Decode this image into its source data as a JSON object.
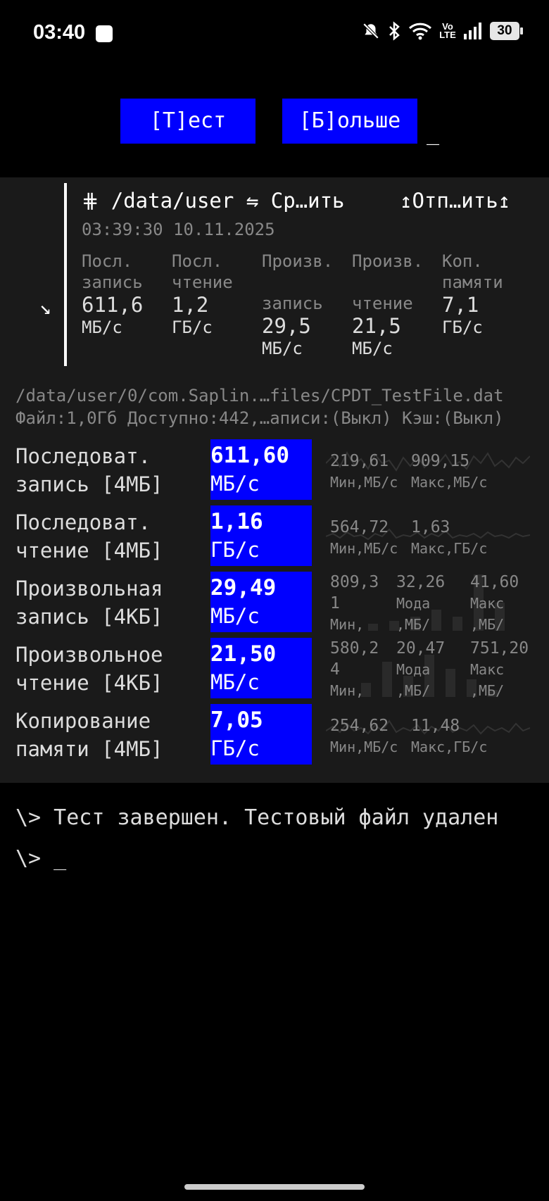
{
  "status_bar": {
    "time": "03:40",
    "battery": "30",
    "volte": "Vo LTE",
    "icons": [
      "notification-app-icon",
      "mute-icon",
      "bluetooth-icon",
      "wifi-icon",
      "volte-icon",
      "signal-icon",
      "battery-icon"
    ]
  },
  "toolbar": {
    "test_label": "[Т]ест",
    "more_label": "[Б]ольше",
    "cursor": "_"
  },
  "summary": {
    "header_left": "⋕  /data/user ⇋ Ср…ить",
    "header_right": "↥Отп…ить↥",
    "date": "03:39:30 10.11.2025",
    "arrow": "↘",
    "columns": [
      {
        "label1": "Посл.",
        "label2": "запись",
        "value": "611,6",
        "unit": "МБ/с"
      },
      {
        "label1": "Посл.",
        "label2": "чтение",
        "value": "1,2",
        "unit": "ГБ/с"
      },
      {
        "label1": "Произв.",
        "label2": "запись",
        "value": "29,5",
        "unit": "МБ/с"
      },
      {
        "label1": "Произв.",
        "label2": "чтение",
        "value": "21,5",
        "unit": "МБ/с"
      },
      {
        "label1": "Коп.",
        "label2": "памяти",
        "value": "7,1",
        "unit": "ГБ/с"
      }
    ]
  },
  "file_path": "/data/user/0/com.Saplin.…files/CPDT_TestFile.dat",
  "file_info": "Файл:1,0Гб Доступно:442,…аписи:(Выкл) Кэш:(Выкл)",
  "results": [
    {
      "name1": "Последоват.",
      "name2": "запись [4МБ]",
      "value": "611,60",
      "unit": "МБ/с",
      "stats": [
        {
          "v": "219,61",
          "l": "Мин,МБ/с"
        },
        {
          "v": "909,15",
          "l": "Макс,МБ/с"
        }
      ]
    },
    {
      "name1": "Последоват.",
      "name2": "чтение [4МБ]",
      "value": "1,16",
      "unit": "ГБ/с",
      "stats": [
        {
          "v": "564,72",
          "l": "Мин,МБ/с"
        },
        {
          "v": "1,63",
          "l": "Макс,ГБ/с"
        }
      ]
    },
    {
      "name1": "Произвольная",
      "name2": "запись [4КБ]",
      "value": "29,49",
      "unit": "МБ/с",
      "stats": [
        {
          "v": "809,3",
          "v2": "1",
          "l": "Мин,"
        },
        {
          "v": "32,26",
          "v2": "Мода",
          "l": ",МБ/"
        },
        {
          "v": "41,60",
          "v2": "Макс",
          "l": ",МБ/"
        }
      ]
    },
    {
      "name1": "Произвольное",
      "name2": "чтение [4КБ]",
      "value": "21,50",
      "unit": "МБ/с",
      "stats": [
        {
          "v": "580,2",
          "v2": "4",
          "l": "Мин,"
        },
        {
          "v": "20,47",
          "v2": "Мода",
          "l": ",МБ/"
        },
        {
          "v": "751,20",
          "v2": "Макс",
          "l": ",МБ/"
        }
      ]
    },
    {
      "name1": "Копирование",
      "name2": "памяти [4МБ]",
      "value": "7,05",
      "unit": "ГБ/с",
      "stats": [
        {
          "v": "254,62",
          "l": "Мин,МБ/с"
        },
        {
          "v": "11,48",
          "l": "Макс,ГБ/с"
        }
      ]
    }
  ],
  "console": {
    "line1": "\\> Тест завершен. Тестовый файл удален",
    "line2": "\\> _"
  },
  "colors": {
    "accent_blue": "#0000ff",
    "panel_bg": "#1a1a1a",
    "muted": "#888888"
  }
}
